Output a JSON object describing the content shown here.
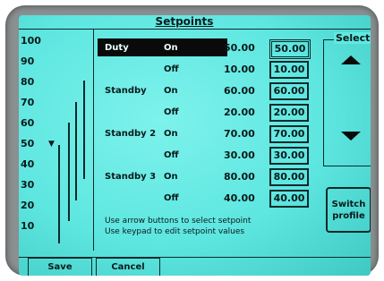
{
  "title": "Setpoints",
  "scale": {
    "ticks": [
      "100",
      "90",
      "80",
      "70",
      "60",
      "50",
      "40",
      "30",
      "20",
      "10"
    ],
    "marker": "▼"
  },
  "rows": [
    {
      "label": "Duty",
      "state": "On",
      "value": "50.00",
      "box": "50.00",
      "selected": true
    },
    {
      "label": "",
      "state": "Off",
      "value": "10.00",
      "box": "10.00"
    },
    {
      "label": "Standby",
      "state": "On",
      "value": "60.00",
      "box": "60.00"
    },
    {
      "label": "",
      "state": "Off",
      "value": "20.00",
      "box": "20.00"
    },
    {
      "label": "Standby 2",
      "state": "On",
      "value": "70.00",
      "box": "70.00"
    },
    {
      "label": "",
      "state": "Off",
      "value": "30.00",
      "box": "30.00"
    },
    {
      "label": "Standby 3",
      "state": "On",
      "value": "80.00",
      "box": "80.00"
    },
    {
      "label": "",
      "state": "Off",
      "value": "40.00",
      "box": "40.00"
    }
  ],
  "hints": [
    "Use arrow buttons to select setpoint",
    "Use keypad to edit setpoint values"
  ],
  "select": {
    "title": "Select",
    "up_icon": "arrow-up-icon",
    "down_icon": "arrow-down-icon"
  },
  "switch_profile": "Switch\nprofile",
  "buttons": {
    "save": "Save",
    "cancel": "Cancel"
  },
  "colors": {
    "screen": "#5ee6e0",
    "ink": "#0a1a1a",
    "bezel": "#8a8f90"
  }
}
